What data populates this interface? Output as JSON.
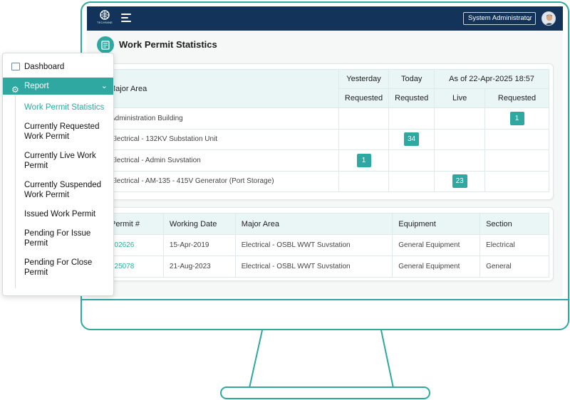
{
  "header": {
    "logo_text": "TECHNINE",
    "user_select": "System Administrator"
  },
  "page": {
    "title": "Work Permit Statistics"
  },
  "sidebar": {
    "dashboard_label": "Dashboard",
    "report_label": "Report",
    "sub_items": [
      "Work Permit Statistics",
      "Currently Requested Work Permit",
      "Currently Live Work Permit",
      "Currently Suspended Work Permit",
      "Issued Work Permit",
      "Pending For Issue Permit",
      "Pending For Close Permit"
    ]
  },
  "stats_table": {
    "col_major_area": "Major Area",
    "group_yesterday": "Yesterday",
    "group_today": "Today",
    "group_asof": "As of 22-Apr-2025 18:57",
    "sub_yesterday": "Requested",
    "sub_today": "Requsted",
    "sub_live": "Live",
    "sub_requested": "Requested",
    "rows": [
      {
        "area": "Administration Building",
        "yesterday": "",
        "today": "",
        "live": "",
        "requested": "1"
      },
      {
        "area": "Electrical - 132KV Substation Unit",
        "yesterday": "",
        "today": "34",
        "live": "",
        "requested": ""
      },
      {
        "area": "Electrical - Admin Suvstation",
        "yesterday": "1",
        "today": "",
        "live": "",
        "requested": ""
      },
      {
        "area": "Electrical - AM-135 - 415V Generator (Port Storage)",
        "yesterday": "",
        "today": "",
        "live": "23",
        "requested": ""
      }
    ]
  },
  "permit_table": {
    "headers": [
      "Permit #",
      "Working Date",
      "Major Area",
      "Equipment",
      "Section"
    ],
    "rows": [
      {
        "permit": "202626",
        "date": "15-Apr-2019",
        "area": "Electrical - OSBL WWT Suvstation",
        "equipment": "General Equipment",
        "section": "Electrical"
      },
      {
        "permit": "125078",
        "date": "21-Aug-2023",
        "area": "Electrical - OSBL WWT Suvstation",
        "equipment": "General Equipment",
        "section": "General"
      }
    ]
  },
  "colors": {
    "accent": "#2ea8a0",
    "header_bg": "#14335a",
    "table_header_bg": "#eaf6f5"
  }
}
